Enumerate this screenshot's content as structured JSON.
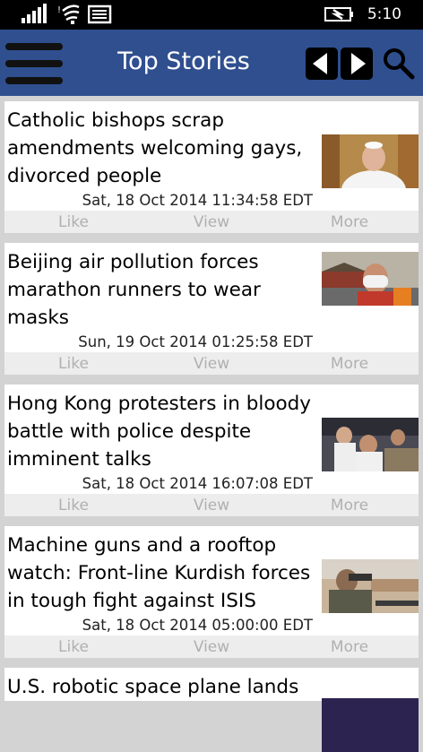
{
  "status_bar": {
    "time": "5:10",
    "icons": [
      "signal-bars-icon",
      "wifi-icon",
      "message-icon",
      "battery-charging-icon"
    ]
  },
  "header": {
    "title": "Top Stories",
    "menu_icon": "hamburger-menu-icon",
    "prev_icon": "arrow-left-icon",
    "next_icon": "arrow-right-icon",
    "search_icon": "search-icon",
    "background": "#2f4f8f"
  },
  "actions": {
    "like": "Like",
    "view": "View",
    "more": "More"
  },
  "stories": [
    {
      "headline": "Catholic bishops scrap amendments welcoming gays, divorced people",
      "date": "Sat, 18 Oct 2014 11:34:58 EDT"
    },
    {
      "headline": "Beijing air pollution forces marathon runners to wear masks",
      "date": "Sun, 19 Oct 2014 01:25:58 EDT"
    },
    {
      "headline": "Hong Kong protesters in bloody battle with police despite imminent talks",
      "date": "Sat, 18 Oct 2014 16:07:08 EDT"
    },
    {
      "headline": "Machine guns and a rooftop watch: Front-line Kurdish forces in tough fight against ISIS",
      "date": "Sat, 18 Oct 2014 05:00:00 EDT"
    },
    {
      "headline": "U.S. robotic space plane lands"
    }
  ]
}
